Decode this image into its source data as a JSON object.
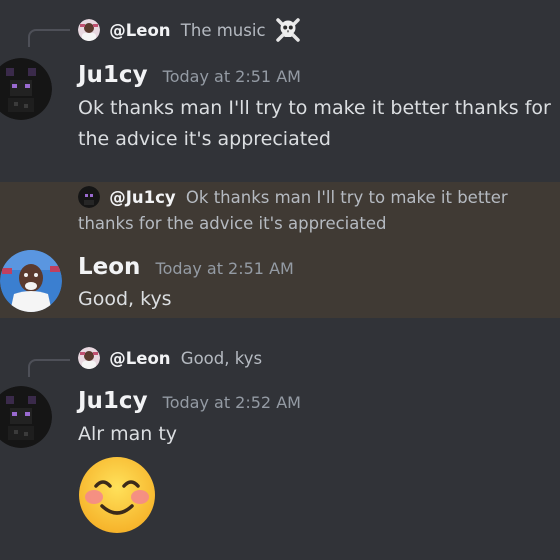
{
  "messages": [
    {
      "reply": {
        "username": "@Leon",
        "text": "The music",
        "icon": "skull-crossbones-icon"
      },
      "author": "Ju1cy",
      "timestamp": "Today at 2:51 AM",
      "text": "Ok thanks man I'll try to make it better thanks for the advice it's appreciated"
    },
    {
      "highlighted": true,
      "reply": {
        "username": "@Ju1cy",
        "text": "Ok thanks man I'll try to make it better thanks for the advice it's appreciated"
      },
      "author": "Leon",
      "timestamp": "Today at 2:51 AM",
      "text": "Good, kys"
    },
    {
      "reply": {
        "username": "@Leon",
        "text": "Good, kys"
      },
      "author": "Ju1cy",
      "timestamp": "Today at 2:52 AM",
      "text": "Alr man ty",
      "emoji": "smiling-face-with-blush"
    }
  ],
  "colors": {
    "background": "#313338",
    "highlight": "#403a34",
    "username": "#f2f3f5",
    "timestamp": "#949ba4",
    "text": "#dbdee1"
  }
}
